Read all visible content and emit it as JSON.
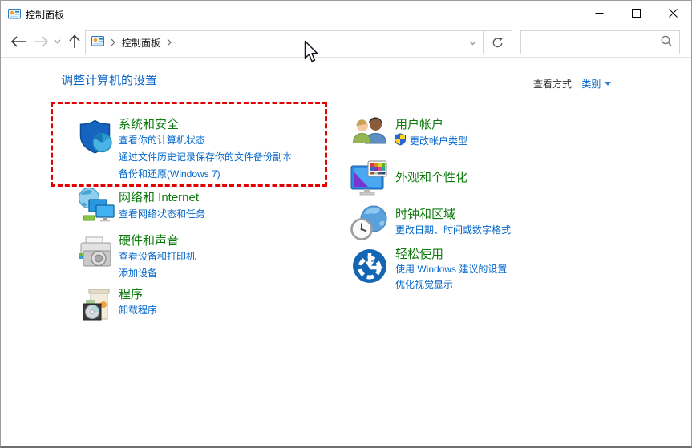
{
  "window": {
    "title": "控制面板"
  },
  "toolbar": {
    "breadcrumb_root": "控制面板",
    "search_value": ""
  },
  "header": {
    "title": "调整计算机的设置",
    "view_by_label": "查看方式:",
    "view_by_value": "类别"
  },
  "categories": {
    "left": [
      {
        "title": "系统和安全",
        "highlighted": true,
        "links": [
          "查看你的计算机状态",
          "通过文件历史记录保存你的文件备份副本",
          "备份和还原(Windows 7)"
        ]
      },
      {
        "title": "网络和 Internet",
        "links": [
          "查看网络状态和任务"
        ]
      },
      {
        "title": "硬件和声音",
        "links": [
          "查看设备和打印机",
          "添加设备"
        ]
      },
      {
        "title": "程序",
        "links": [
          "卸载程序"
        ]
      }
    ],
    "right": [
      {
        "title": "用户帐户",
        "links": [
          "更改帐户类型"
        ],
        "link_has_uac_shield": true
      },
      {
        "title": "外观和个性化",
        "links": []
      },
      {
        "title": "时钟和区域",
        "links": [
          "更改日期、时间或数字格式"
        ]
      },
      {
        "title": "轻松使用",
        "links": [
          "使用 Windows 建议的设置",
          "优化视觉显示"
        ]
      }
    ]
  },
  "colors": {
    "category_title_green": "#0c7a0c",
    "link_blue": "#0066cc",
    "header_blue": "#0a64c4",
    "highlight_red": "#e30000"
  },
  "icons": {
    "titlebar": "control-panel-icon",
    "toolbar": [
      "back-icon",
      "forward-icon",
      "chevron-down-icon",
      "up-icon",
      "refresh-icon",
      "search-icon"
    ],
    "categories": [
      "security-shield-icon",
      "network-globe-monitors-icon",
      "printer-sound-icon",
      "software-box-cd-icon",
      "two-users-icon",
      "monitor-palette-icon",
      "globe-clock-icon",
      "ease-of-access-icon",
      "uac-shield-icon"
    ]
  }
}
